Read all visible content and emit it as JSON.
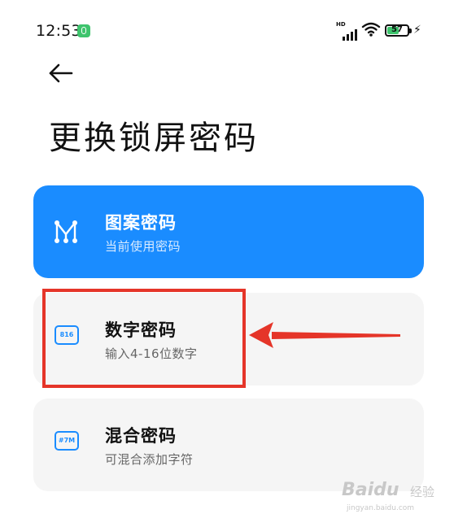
{
  "status_bar": {
    "time": "12:53",
    "network": "HD",
    "battery_level": "57",
    "battery_fraction": 0.57,
    "colors": {
      "battery_fill": "#3ec46d",
      "notification": "#3ec46d"
    }
  },
  "header": {
    "back_icon": "arrow-left-icon",
    "title": "更换锁屏密码"
  },
  "options": [
    {
      "title": "图案密码",
      "subtitle": "当前使用密码",
      "icon": "pattern-icon",
      "selected": true
    },
    {
      "title": "数字密码",
      "subtitle": "输入4-16位数字",
      "icon": "numeric-icon",
      "icon_text": "816",
      "selected": false
    },
    {
      "title": "混合密码",
      "subtitle": "可混合添加字符",
      "icon": "mixed-icon",
      "icon_text": "#7M",
      "selected": false
    }
  ],
  "annotation": {
    "color": "#e53529",
    "target": "数字密码"
  },
  "colors": {
    "accent": "#1a8cff",
    "card_bg": "#f5f5f5"
  },
  "watermark": {
    "brand": "Baidu",
    "suffix": "经验",
    "url": "jingyan.baidu.com"
  }
}
